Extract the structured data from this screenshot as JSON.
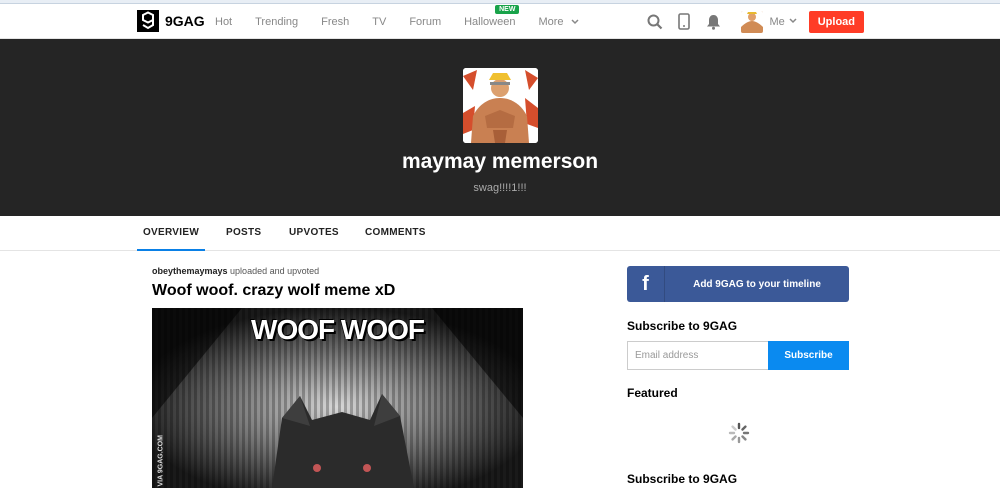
{
  "nav": {
    "logo_text": "9GAG",
    "links": [
      {
        "label": "Hot"
      },
      {
        "label": "Trending"
      },
      {
        "label": "Fresh"
      },
      {
        "label": "TV"
      },
      {
        "label": "Forum"
      },
      {
        "label": "Halloween",
        "badge": "NEW"
      },
      {
        "label": "More"
      }
    ],
    "me_label": "Me",
    "upload_label": "Upload"
  },
  "profile": {
    "name": "maymay memerson",
    "tagline": "swag!!!!1!!!"
  },
  "tabs": [
    "OVERVIEW",
    "POSTS",
    "UPVOTES",
    "COMMENTS"
  ],
  "post": {
    "username": "obeythemaymays",
    "action": " uploaded and upvoted",
    "title": "Woof woof. crazy wolf meme xD",
    "image_caption": "WOOF WOOF",
    "watermark": "VIA 9GAG.COM"
  },
  "sidebar": {
    "fb_label": "Add 9GAG to your timeline",
    "subscribe_heading": "Subscribe to 9GAG",
    "email_placeholder": "Email address",
    "subscribe_button": "Subscribe",
    "featured_heading": "Featured",
    "subscribe_heading_2": "Subscribe to 9GAG"
  },
  "colors": {
    "upload": "#ff3c26",
    "facebook": "#3b5998",
    "subscribe": "#0a8af0",
    "active_tab": "#0a80e6",
    "hero_bg": "#252525"
  },
  "icons": [
    "search-icon",
    "mobile-icon",
    "bell-icon",
    "chevron-down-icon",
    "facebook-icon",
    "loading-spinner-icon"
  ]
}
